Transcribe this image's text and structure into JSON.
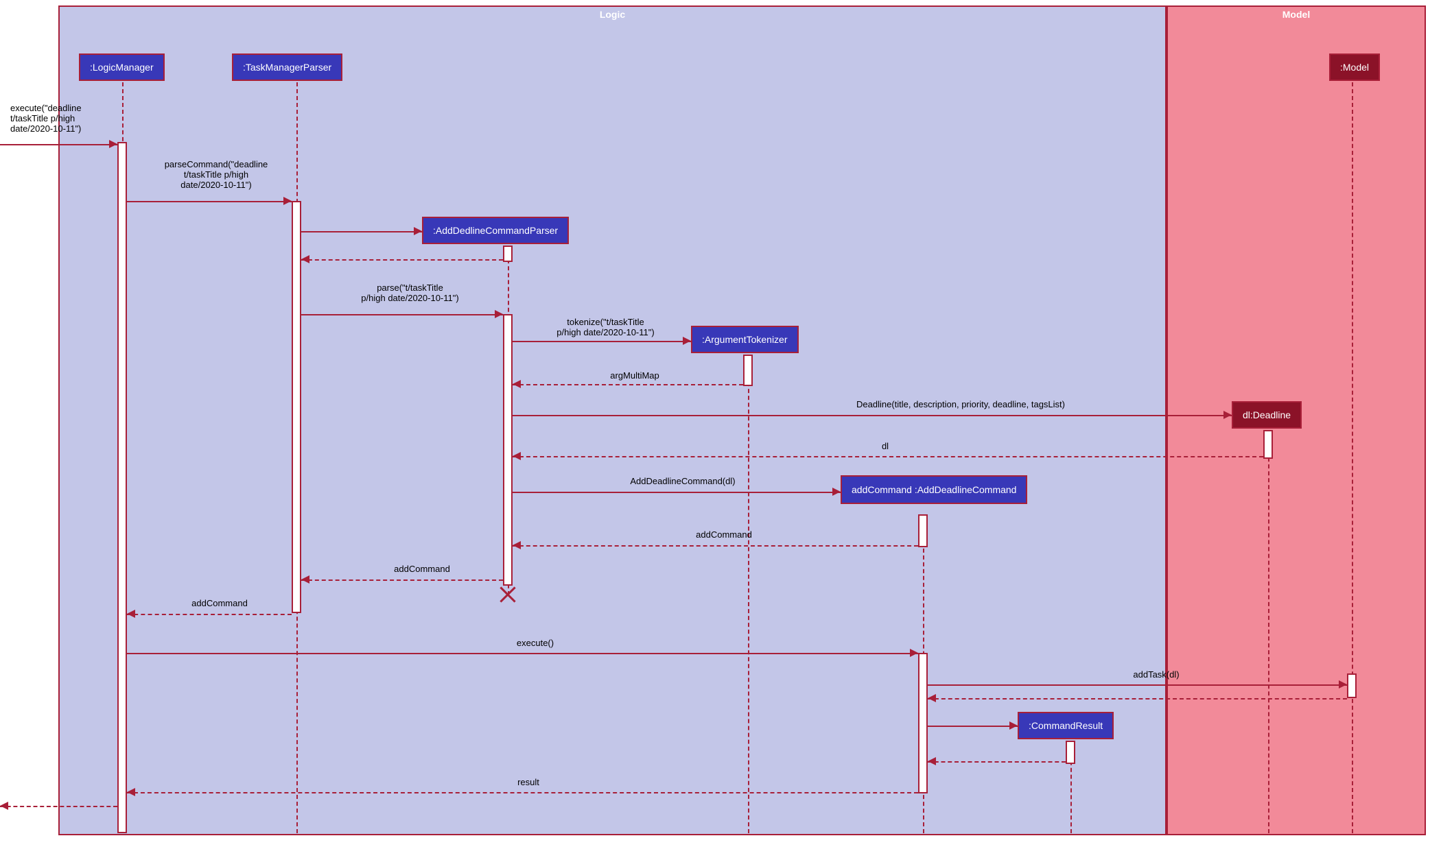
{
  "frames": {
    "logic": "Logic",
    "model": "Model"
  },
  "participants": {
    "logicManager": ":LogicManager",
    "taskManagerParser": ":TaskManagerParser",
    "addDeadlineCommandParser": ":AddDedlineCommandParser",
    "argumentTokenizer": ":ArgumentTokenizer",
    "deadline": "dl:Deadline",
    "addDeadlineCommand": "addCommand\n:AddDeadlineCommand",
    "commandResult": ":CommandResult",
    "model": ":Model"
  },
  "messages": {
    "m1": "execute(\"deadline\nt/taskTitle p/high\ndate/2020-10-11\")",
    "m2": "parseCommand(\"deadline\nt/taskTitle p/high\ndate/2020-10-11\")",
    "m3": "parse(\"t/taskTitle\np/high date/2020-10-11\")",
    "m4": "tokenize(\"t/taskTitle\np/high date/2020-10-11\")",
    "m5": "argMultiMap",
    "m6": "Deadline(title, description, priority, deadline, tagsList)",
    "m7": "dl",
    "m8": "AddDeadlineCommand(dl)",
    "m9": "addCommand",
    "m10": "addCommand",
    "m11": "addCommand",
    "m12": "execute()",
    "m13": "addTask(dl)",
    "m14": "result"
  }
}
